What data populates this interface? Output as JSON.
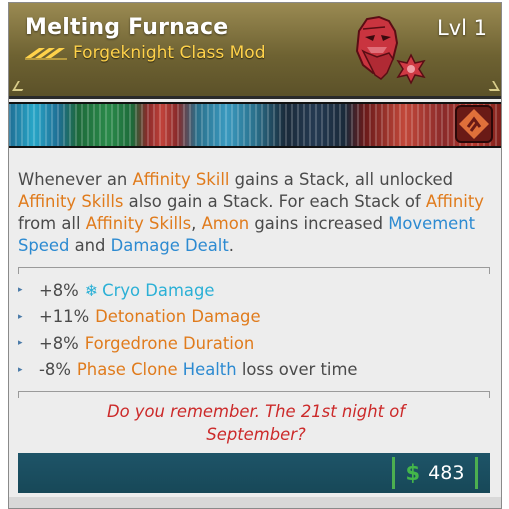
{
  "item": {
    "name": "Melting Furnace",
    "level": "Lvl 1",
    "type": "Forgeknight Class Mod",
    "rarity_color": "#ffd24a",
    "header_color": "#7a6b38"
  },
  "description": {
    "p1": "Whenever an ",
    "h1": "Affinity Skill",
    "p2": " gains a Stack, all unlocked ",
    "h2": "Affinity Skills",
    "p3": " also gain a Stack. For each Stack of ",
    "h3": "Affinity",
    "p4": " from all ",
    "h4": "Affinity Skills",
    "p5": ", ",
    "h5": "Amon",
    "p6": " gains increased ",
    "b1": "Movement Speed",
    "p7": " and ",
    "b2": "Damage Dealt",
    "p8": "."
  },
  "stats": [
    {
      "value": "+8%",
      "icon": "snowflake-icon",
      "label": "Cryo Damage",
      "suffix": ""
    },
    {
      "value": "+11%",
      "label": "Detonation Damage",
      "suffix": ""
    },
    {
      "value": "+8%",
      "label": "Forgedrone Duration",
      "suffix": ""
    },
    {
      "value": "-8%",
      "label": "Phase Clone",
      "blue": "Health",
      "suffix": "loss over time"
    }
  ],
  "flavor": {
    "line1": "Do you remember. The 21st night of",
    "line2": "September?"
  },
  "price": {
    "symbol": "$",
    "amount": "483"
  },
  "colors": {
    "orange": "#e07b1c",
    "blue": "#2c8ad1",
    "cryo": "#2bb0d6",
    "flavor_red": "#cc2a2a",
    "money_green": "#43b64a"
  }
}
